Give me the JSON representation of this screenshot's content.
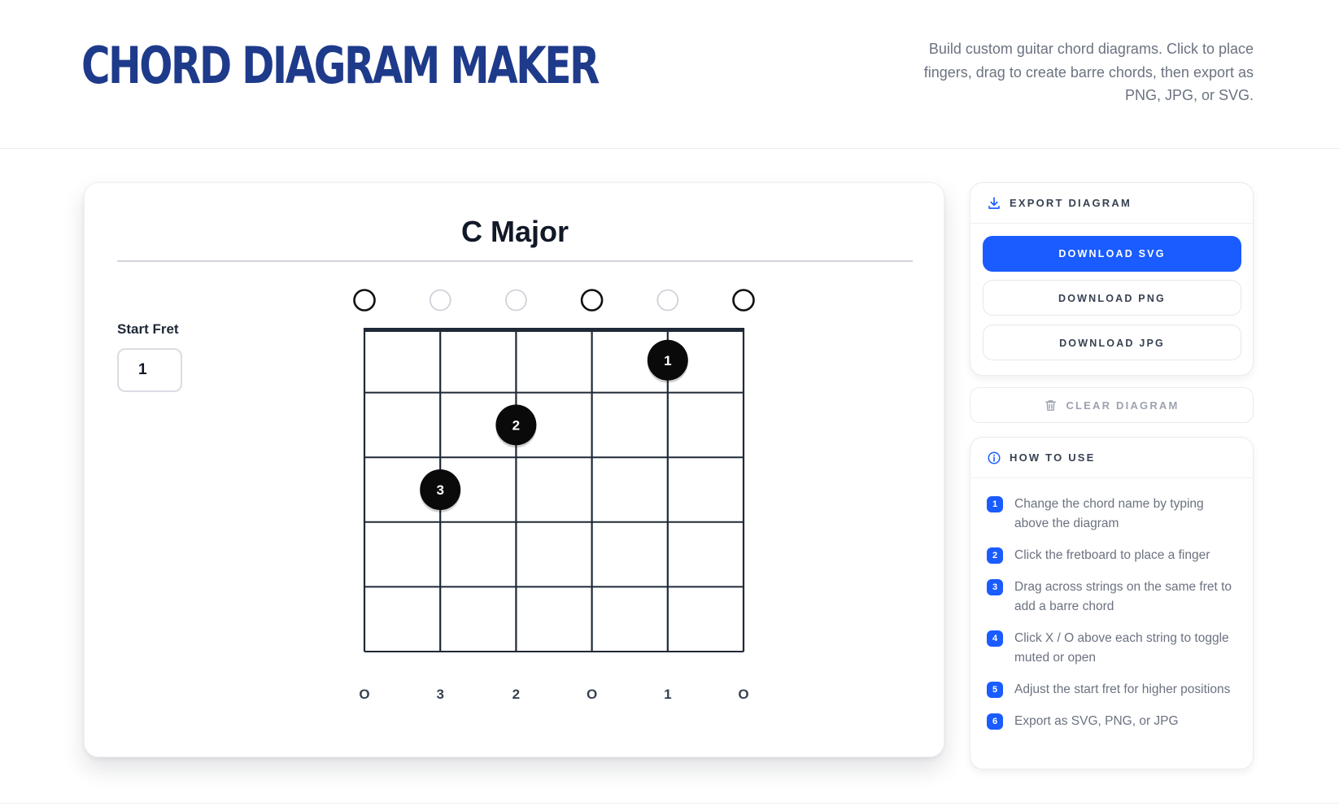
{
  "header": {
    "title": "CHORD DIAGRAM MAKER",
    "description": "Build custom guitar chord diagrams. Click to place fingers, drag to create barre chords, then export as PNG, JPG, or SVG."
  },
  "editor": {
    "chord_name": "C Major",
    "start_fret_label": "Start Fret",
    "start_fret_value": "1",
    "string_states": [
      "open",
      "muted",
      "muted",
      "open",
      "muted",
      "open"
    ],
    "fingers": [
      {
        "string": 5,
        "fret": 1,
        "label": "1"
      },
      {
        "string": 3,
        "fret": 2,
        "label": "2"
      },
      {
        "string": 2,
        "fret": 3,
        "label": "3"
      }
    ],
    "bottom_labels": [
      "O",
      "3",
      "2",
      "O",
      "1",
      "O"
    ]
  },
  "export_panel": {
    "title": "EXPORT DIAGRAM",
    "icon": "download-icon",
    "download_svg": "DOWNLOAD SVG",
    "download_png": "DOWNLOAD PNG",
    "download_jpg": "DOWNLOAD JPG"
  },
  "clear": {
    "label": "CLEAR DIAGRAM",
    "icon": "trash-icon"
  },
  "howto": {
    "title": "HOW TO USE",
    "icon": "info-icon",
    "steps": [
      {
        "num": "1",
        "text": "Change the chord name by typing above the diagram"
      },
      {
        "num": "2",
        "text": "Click the fretboard to place a finger"
      },
      {
        "num": "3",
        "text": "Drag across strings on the same fret to add a barre chord"
      },
      {
        "num": "4",
        "text": "Click X / O above each string to toggle muted or open"
      },
      {
        "num": "5",
        "text": "Adjust the start fret for higher positions"
      },
      {
        "num": "6",
        "text": "Export as SVG, PNG, or JPG"
      }
    ]
  },
  "colors": {
    "brand": "#1e3a8a",
    "accent": "#1a5cff",
    "finger": "#0a0a0a",
    "grid": "#1f2937"
  }
}
